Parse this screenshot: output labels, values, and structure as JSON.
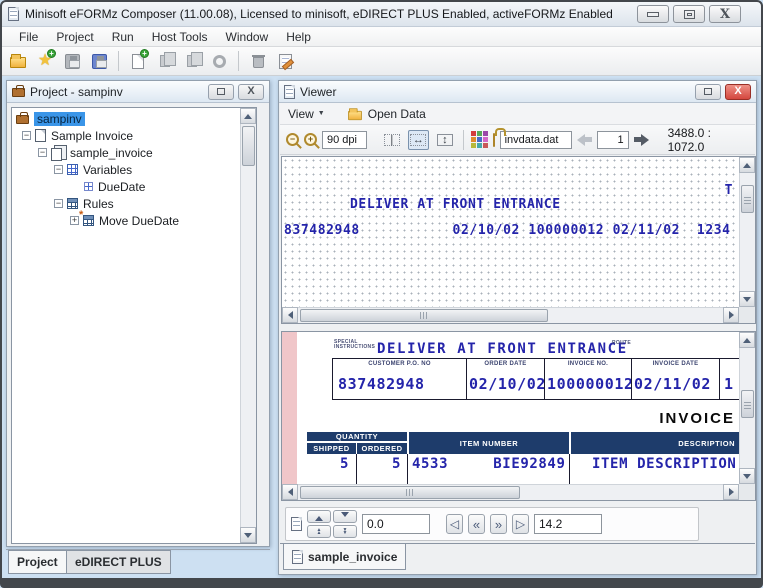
{
  "window": {
    "title": "Minisoft eFORMz Composer (11.00.08), Licensed to minisoft, eDIRECT PLUS Enabled, activeFORMz Enabled",
    "menu": [
      "File",
      "Project",
      "Run",
      "Host Tools",
      "Window",
      "Help"
    ],
    "toolbar_icons": [
      "open-project",
      "new-project",
      "save",
      "save-all",
      "new-form",
      "copy",
      "paste",
      "refresh",
      "delete",
      "properties"
    ]
  },
  "colors": {
    "desktop": "#cde0f2",
    "data_text": "#2424aa",
    "table_header_navy": "#1e3c6b",
    "pink_stripe": "#f0c6c9",
    "close_red": "#d4473e"
  },
  "project_panel": {
    "title": "Project - sampinv",
    "tree": [
      {
        "label": "sampinv"
      },
      {
        "label": "Sample Invoice"
      },
      {
        "label": "sample_invoice"
      },
      {
        "label": "Variables"
      },
      {
        "label": "DueDate"
      },
      {
        "label": "Rules"
      },
      {
        "label": "Move DueDate"
      }
    ],
    "tabs": [
      {
        "label": "Project"
      },
      {
        "label": "eDIRECT PLUS"
      }
    ]
  },
  "viewer": {
    "title": "Viewer",
    "menu": {
      "view": "View",
      "open_data": "Open Data"
    },
    "toolbar": {
      "dpi": "90 dpi",
      "data_file": "invdata.dat",
      "page": "1",
      "coords": "3488.0 : 1072.0"
    },
    "raw_view": {
      "overflow_text": "T",
      "line1": "DELIVER AT FRONT ENTRANCE",
      "line2": "837482948           02/10/02 100000012 02/11/02  1234"
    },
    "form_view": {
      "special_instructions_label": "SPECIAL INSTRUCTIONS",
      "deliver_text": "DELIVER AT FRONT ENTRANCE",
      "route_label": "ROUTE",
      "columns": [
        {
          "label": "CUSTOMER P.O. NO",
          "value": "837482948"
        },
        {
          "label": "ORDER DATE",
          "value": "02/10/02"
        },
        {
          "label": "INVOICE NO.",
          "value": "100000012"
        },
        {
          "label": "INVOICE DATE",
          "value": "02/11/02"
        },
        {
          "label": "",
          "value": "1"
        }
      ],
      "invoice_title": "INVOICE",
      "items_table": {
        "quantity_label": "QUANTITY",
        "shipped_label": "SHIPPED",
        "ordered_label": "ORDERED",
        "item_number_label": "ITEM NUMBER",
        "description_label": "DESCRIPTION",
        "row": {
          "shipped": "5",
          "ordered": "5",
          "item_number": "4533     BIE92849",
          "description": "ITEM DESCRIPTION"
        }
      }
    },
    "position_bar": {
      "vertical": "0.0",
      "horizontal": "14.2"
    },
    "tab": "sample_invoice"
  }
}
